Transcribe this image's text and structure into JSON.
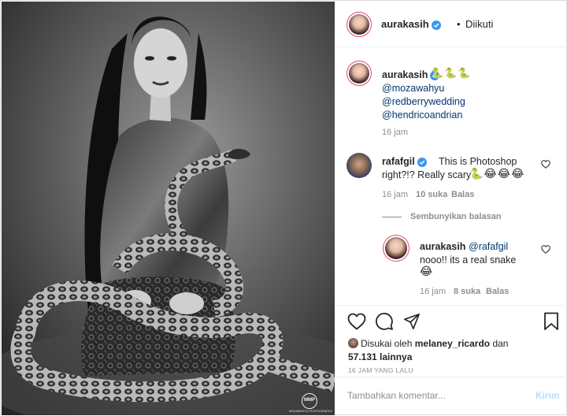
{
  "header": {
    "username": "aurakasih",
    "separator": "•",
    "follow_status": "Diikuti"
  },
  "caption": {
    "username": "aurakasih",
    "emojis": "🐍🐍🐍",
    "mentions": [
      "@mozawahyu",
      "@redberrywedding",
      "@hendricoandrian"
    ],
    "time": "16 jam"
  },
  "comment": {
    "username": "rafafgil",
    "text_line1": "This is Photoshop",
    "text_line2": "right?!? Really scary",
    "emojis": "🐍😂😂😂",
    "time": "16 jam",
    "likes": "10 suka",
    "reply_label": "Balas",
    "toggle_replies": "Sembunyikan balasan"
  },
  "reply": {
    "username": "aurakasih",
    "mention": "@rafafgil",
    "text": "nooo!! its a real snake",
    "emoji": "😂",
    "time": "16 jam",
    "likes": "8 suka",
    "reply_label": "Balas"
  },
  "likes": {
    "prefix": "Disukai oleh",
    "user": "melaney_ricardo",
    "joiner": "dan",
    "count": "57.131 lainnya"
  },
  "post_time": "16 JAM YANG LALU",
  "add_comment": {
    "placeholder": "Tambahkan komentar...",
    "post_label": "Kirim"
  },
  "photo": {
    "watermark_mark": "MMP",
    "watermark_text": "MOZAWAHYU PHOTOGRAPHY"
  },
  "colors": {
    "link": "#00376b",
    "verified": "#3897f0",
    "story_ring": "#e8447a",
    "post_button": "#b2dffc"
  }
}
